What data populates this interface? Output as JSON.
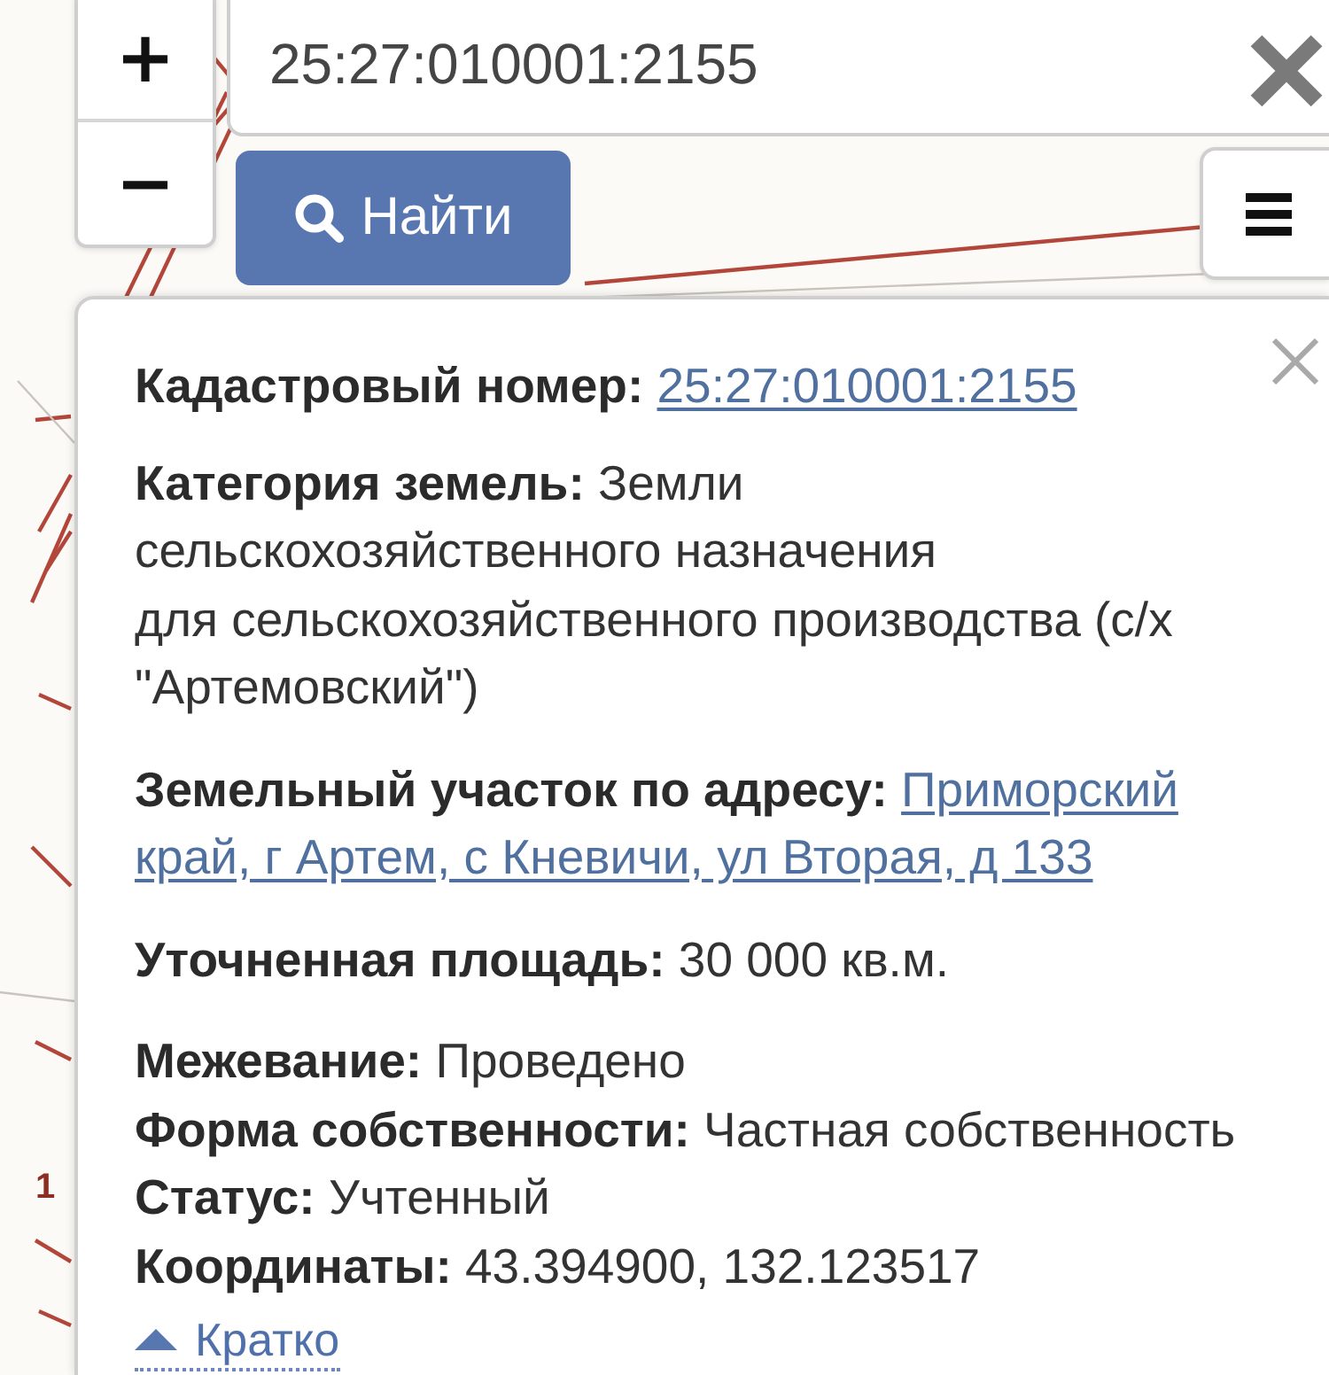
{
  "map": {
    "labels": [
      {
        "text": "1"
      }
    ]
  },
  "zoom": {
    "zoom_in": "+",
    "zoom_out": "−"
  },
  "search": {
    "value": "25:27:010001:2155",
    "button": "Найти"
  },
  "popup": {
    "sections": [
      {
        "rows": [
          {
            "kind": "link",
            "label": "Кадастровый номер:",
            "lines": [
              "25:27:010001:2155"
            ]
          }
        ]
      },
      {
        "rows": [
          {
            "kind": "text",
            "label": "Категория земель:",
            "lines": [
              "Земли сельскохозяйственного назначения",
              "для сельскохозяйственного производства (с/х \"Артемовский\")"
            ]
          }
        ]
      },
      {
        "rows": [
          {
            "kind": "link",
            "label": "Земельный участок по адресу:",
            "lines": [
              "Приморский",
              "край, г Артем, с Кневичи, ул Вторая, д 133"
            ]
          }
        ]
      },
      {
        "rows": [
          {
            "kind": "text",
            "label": "Уточненная площадь:",
            "lines": [
              "30 000 кв.м."
            ]
          }
        ]
      },
      {
        "rows": [
          {
            "kind": "text",
            "label": "Межевание:",
            "lines": [
              "Проведено"
            ]
          },
          {
            "kind": "text",
            "label": "Форма собственности:",
            "lines": [
              "Частная собственность"
            ]
          },
          {
            "kind": "text",
            "label": "Статус:",
            "lines": [
              "Учтенный"
            ]
          },
          {
            "kind": "text",
            "label": "Координаты:",
            "lines": [
              "43.394900, 132.123517"
            ]
          }
        ]
      }
    ],
    "toggle": "Кратко"
  }
}
